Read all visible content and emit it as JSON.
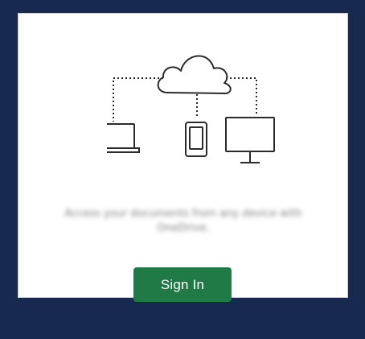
{
  "message": {
    "line1": "Access your documents from any device with",
    "line2": "OneDrive."
  },
  "signin": {
    "label": "Sign In",
    "color": "#1f7a45"
  },
  "illustration": {
    "icons": [
      "cloud-icon",
      "laptop-icon",
      "phone-icon",
      "monitor-icon"
    ]
  }
}
